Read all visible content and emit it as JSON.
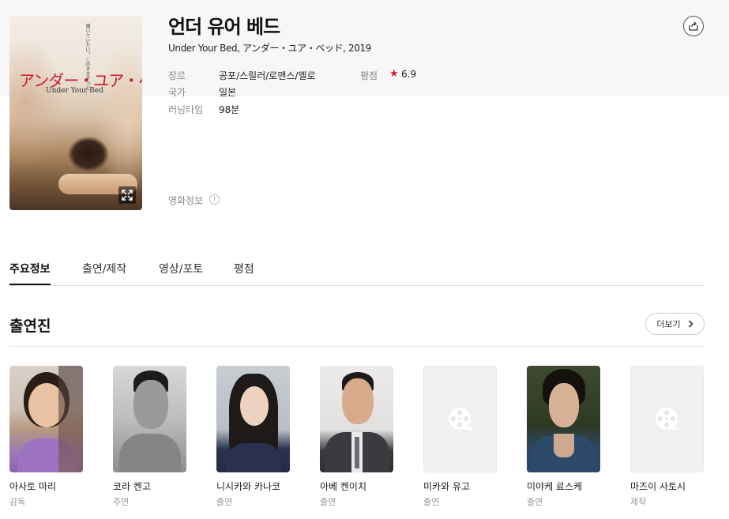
{
  "movie": {
    "title": "언더 유어 베드",
    "subtitle": "Under Your Bed, アンダー・ユア・ベッド, 2019",
    "poster": {
      "title_jp": "アンダー・ユア・ベッド",
      "title_en": "Under Your Bed",
      "tagline": "覗いていたい。このままずっと…"
    },
    "meta": {
      "genre_label": "장르",
      "genre_value": "공포/스릴러/로맨스/멜로",
      "country_label": "국가",
      "country_value": "일본",
      "runtime_label": "러닝타임",
      "runtime_value": "98분",
      "rating_label": "평점",
      "rating_value": "6.9"
    },
    "info_link": "영화정보",
    "info_icon_glyph": "!"
  },
  "tabs": [
    {
      "label": "주요정보",
      "active": true
    },
    {
      "label": "출연/제작",
      "active": false
    },
    {
      "label": "영상/포토",
      "active": false
    },
    {
      "label": "평점",
      "active": false
    }
  ],
  "cast_section": {
    "title": "출연진",
    "more_label": "더보기"
  },
  "cast": [
    {
      "name": "아사토 마리",
      "role": "감독"
    },
    {
      "name": "코라 켄고",
      "role": "주연"
    },
    {
      "name": "니시카와 카나코",
      "role": "출연"
    },
    {
      "name": "아베 켄이치",
      "role": "출연"
    },
    {
      "name": "미카와 유고",
      "role": "출연"
    },
    {
      "name": "미야케 료스케",
      "role": "출연"
    },
    {
      "name": "마즈이 사토시",
      "role": "제작"
    }
  ],
  "colors": {
    "accent_star": "#e3172b",
    "poster_title": "#c8192b"
  }
}
